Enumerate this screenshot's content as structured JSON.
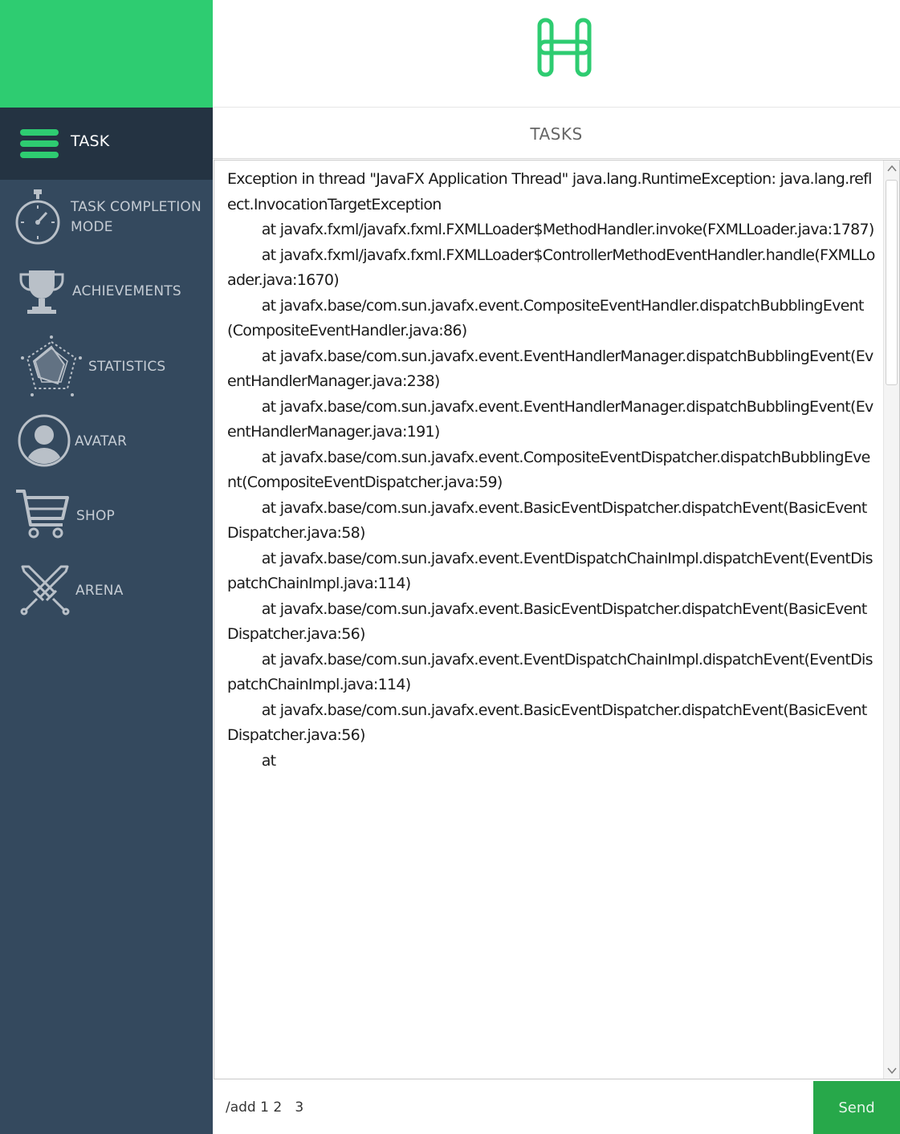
{
  "app": {
    "logo_icon": "h-logo-icon",
    "accent_color": "#2ecc71",
    "sidebar_color": "#34495e",
    "active_color": "#243342"
  },
  "sidebar": {
    "items": [
      {
        "label": "TASK",
        "icon": "hamburger-icon",
        "active": true
      },
      {
        "label": "TASK COMPLETION\nMODE",
        "icon": "stopwatch-icon",
        "active": false
      },
      {
        "label": "ACHIEVEMENTS",
        "icon": "trophy-icon",
        "active": false
      },
      {
        "label": "STATISTICS",
        "icon": "radar-chart-icon",
        "active": false
      },
      {
        "label": "AVATAR",
        "icon": "user-avatar-icon",
        "active": false
      },
      {
        "label": "SHOP",
        "icon": "shopping-cart-icon",
        "active": false
      },
      {
        "label": "ARENA",
        "icon": "crossed-swords-icon",
        "active": false
      }
    ]
  },
  "main": {
    "title": "TASKS",
    "log": "Exception in thread \"JavaFX Application Thread\" java.lang.RuntimeException: java.lang.reflect.InvocationTargetException\n        at javafx.fxml/javafx.fxml.FXMLLoader$MethodHandler.invoke(FXMLLoader.java:1787)\n        at javafx.fxml/javafx.fxml.FXMLLoader$ControllerMethodEventHandler.handle(FXMLLoader.java:1670)\n        at javafx.base/com.sun.javafx.event.CompositeEventHandler.dispatchBubblingEvent(CompositeEventHandler.java:86)\n        at javafx.base/com.sun.javafx.event.EventHandlerManager.dispatchBubblingEvent(EventHandlerManager.java:238)\n        at javafx.base/com.sun.javafx.event.EventHandlerManager.dispatchBubblingEvent(EventHandlerManager.java:191)\n        at javafx.base/com.sun.javafx.event.CompositeEventDispatcher.dispatchBubblingEvent(CompositeEventDispatcher.java:59)\n        at javafx.base/com.sun.javafx.event.BasicEventDispatcher.dispatchEvent(BasicEventDispatcher.java:58)\n        at javafx.base/com.sun.javafx.event.EventDispatchChainImpl.dispatchEvent(EventDispatchChainImpl.java:114)\n        at javafx.base/com.sun.javafx.event.BasicEventDispatcher.dispatchEvent(BasicEventDispatcher.java:56)\n        at javafx.base/com.sun.javafx.event.EventDispatchChainImpl.dispatchEvent(EventDispatchChainImpl.java:114)\n        at javafx.base/com.sun.javafx.event.BasicEventDispatcher.dispatchEvent(BasicEventDispatcher.java:56)\n        at",
    "input_value": "/add 1 2   3",
    "send_label": "Send"
  }
}
